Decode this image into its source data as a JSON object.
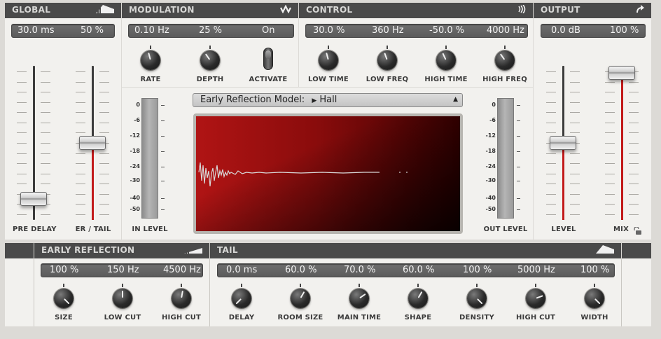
{
  "global": {
    "title": "GLOBAL",
    "values": [
      "30.0 ms",
      "50 %"
    ],
    "pre_delay_label": "PRE DELAY",
    "er_tail_label": "ER / TAIL",
    "pre_delay_level": 0.1,
    "er_tail_level": 0.5
  },
  "modulation": {
    "title": "MODULATION",
    "values": [
      "0.10 Hz",
      "25 %",
      "On"
    ],
    "knobs": [
      {
        "label": "RATE",
        "angle": -15
      },
      {
        "label": "DEPTH",
        "angle": -35
      }
    ],
    "activate_label": "ACTIVATE"
  },
  "control": {
    "title": "CONTROL",
    "values": [
      "30.0 %",
      "360 Hz",
      "-50.0 %",
      "4000 Hz"
    ],
    "knobs": [
      {
        "label": "LOW TIME",
        "angle": -15
      },
      {
        "label": "LOW FREQ",
        "angle": -20
      },
      {
        "label": "HIGH TIME",
        "angle": -25
      },
      {
        "label": "HIGH FREQ",
        "angle": -35
      }
    ]
  },
  "output": {
    "title": "OUTPUT",
    "values": [
      "0.0 dB",
      "100 %"
    ],
    "level_label": "LEVEL",
    "mix_label": "MIX",
    "level_level": 0.5,
    "mix_level": 1.0
  },
  "center": {
    "model_label": "Early Reflection Model:",
    "model_value": "Hall",
    "in_level_label": "IN LEVEL",
    "out_level_label": "OUT LEVEL",
    "meter_scale": [
      "0",
      "-6",
      "-12",
      "-18",
      "-24",
      "-30",
      "-40",
      "-50"
    ]
  },
  "early_reflection": {
    "title": "EARLY REFLECTION",
    "values": [
      "100 %",
      "150 Hz",
      "4500 Hz"
    ],
    "knobs": [
      {
        "label": "SIZE",
        "angle": 135
      },
      {
        "label": "LOW CUT",
        "angle": 0
      },
      {
        "label": "HIGH CUT",
        "angle": 10
      }
    ]
  },
  "tail": {
    "title": "TAIL",
    "values": [
      "0.0 ms",
      "60.0 %",
      "70.0 %",
      "60.0 %",
      "100 %",
      "5000 Hz",
      "100 %"
    ],
    "knobs": [
      {
        "label": "DELAY",
        "angle": -135
      },
      {
        "label": "ROOM SIZE",
        "angle": 30
      },
      {
        "label": "MAIN TIME",
        "angle": 55
      },
      {
        "label": "SHAPE",
        "angle": 30
      },
      {
        "label": "DENSITY",
        "angle": 135
      },
      {
        "label": "HIGH CUT",
        "angle": 70
      },
      {
        "label": "WIDTH",
        "angle": 135
      }
    ]
  },
  "colors": {
    "accent_red": "#c21a1a",
    "header_bg": "#4a4a4a",
    "panel_bg": "#f2f1ee"
  }
}
